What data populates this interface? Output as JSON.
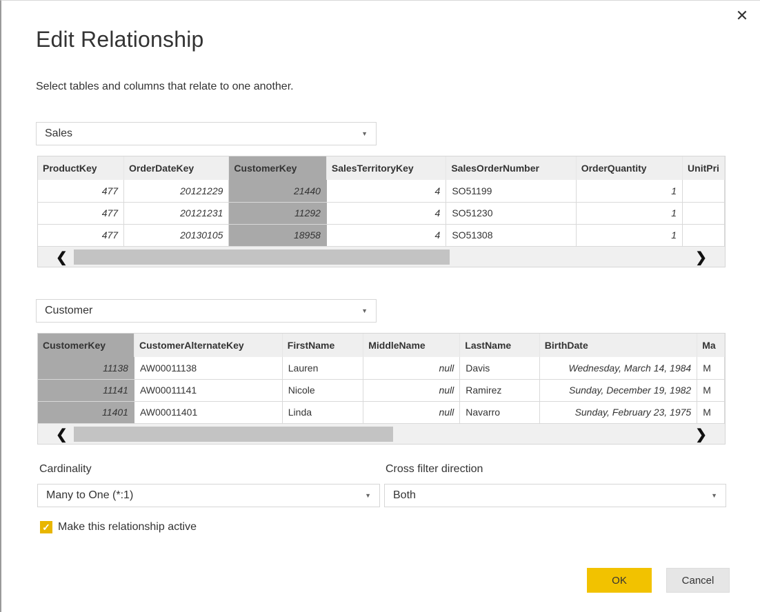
{
  "dialog": {
    "title": "Edit Relationship",
    "subtitle": "Select tables and columns that relate to one another.",
    "close_icon": "close-icon"
  },
  "table1": {
    "selected": "Sales",
    "columns": [
      "ProductKey",
      "OrderDateKey",
      "CustomerKey",
      "SalesTerritoryKey",
      "SalesOrderNumber",
      "OrderQuantity",
      "UnitPri"
    ],
    "selected_column": "CustomerKey",
    "rows": [
      [
        "477",
        "20121229",
        "21440",
        "4",
        "SO51199",
        "1",
        ""
      ],
      [
        "477",
        "20121231",
        "11292",
        "4",
        "SO51230",
        "1",
        ""
      ],
      [
        "477",
        "20130105",
        "18958",
        "4",
        "SO51308",
        "1",
        ""
      ]
    ]
  },
  "table2": {
    "selected": "Customer",
    "columns": [
      "CustomerKey",
      "CustomerAlternateKey",
      "FirstName",
      "MiddleName",
      "LastName",
      "BirthDate",
      "Ma"
    ],
    "selected_column": "CustomerKey",
    "rows": [
      [
        "11138",
        "AW00011138",
        "Lauren",
        "null",
        "Davis",
        "Wednesday, March 14, 1984",
        "M"
      ],
      [
        "11141",
        "AW00011141",
        "Nicole",
        "null",
        "Ramirez",
        "Sunday, December 19, 1982",
        "M"
      ],
      [
        "11401",
        "AW00011401",
        "Linda",
        "null",
        "Navarro",
        "Sunday, February 23, 1975",
        "M"
      ]
    ]
  },
  "scroll": {
    "left_arrow": "❮",
    "right_arrow": "❯"
  },
  "cardinality": {
    "label": "Cardinality",
    "value": "Many to One (*:1)"
  },
  "cross_filter": {
    "label": "Cross filter direction",
    "value": "Both"
  },
  "active_checkbox": {
    "label": "Make this relationship active",
    "checked": true
  },
  "buttons": {
    "ok": "OK",
    "cancel": "Cancel"
  },
  "colors": {
    "accent": "#f2c200",
    "selected_column": "#a9a9a9"
  }
}
